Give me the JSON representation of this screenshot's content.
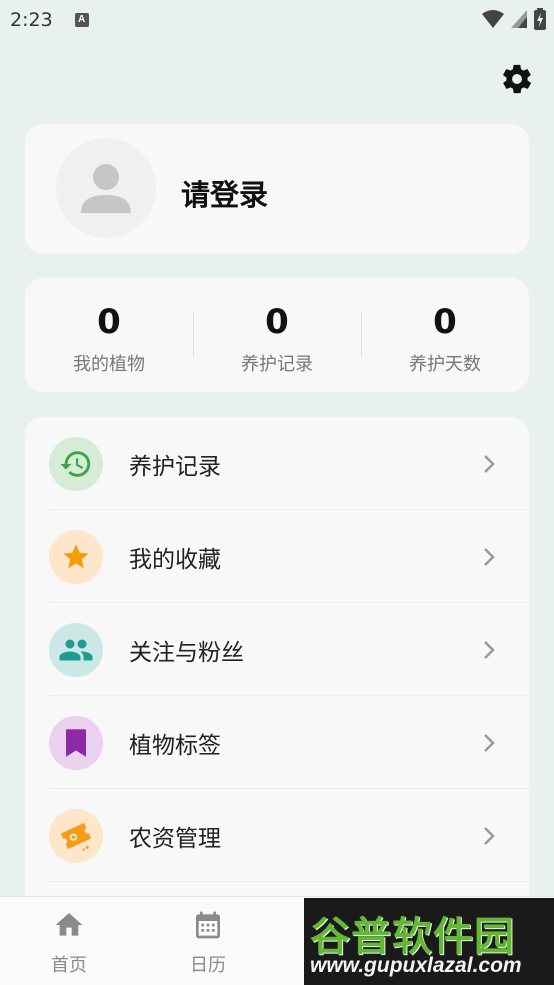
{
  "status_bar": {
    "time": "2:23",
    "notification_badge": "A"
  },
  "header": {
    "settings_icon": "gear-icon"
  },
  "profile": {
    "login_text": "请登录",
    "avatar_icon": "person-icon"
  },
  "stats": [
    {
      "value": "0",
      "label": "我的植物"
    },
    {
      "value": "0",
      "label": "养护记录"
    },
    {
      "value": "0",
      "label": "养护天数"
    }
  ],
  "menu": [
    {
      "label": "养护记录",
      "icon": "history-icon",
      "icon_color": "#43a047",
      "bg_color": "#d5ecd6"
    },
    {
      "label": "我的收藏",
      "icon": "star-icon",
      "icon_color": "#f59c0b",
      "bg_color": "#fde6c9"
    },
    {
      "label": "关注与粉丝",
      "icon": "people-icon",
      "icon_color": "#1f9b92",
      "bg_color": "#cce8e6"
    },
    {
      "label": "植物标签",
      "icon": "bookmark-icon",
      "icon_color": "#8e2aa7",
      "bg_color": "#ead2ee"
    },
    {
      "label": "农资管理",
      "icon": "ticket-icon",
      "icon_color": "#f39d1b",
      "bg_color": "#fde6c9"
    }
  ],
  "bottom_nav": [
    {
      "label": "首页",
      "icon": "home-icon"
    },
    {
      "label": "日历",
      "icon": "calendar-icon"
    }
  ],
  "watermark": {
    "title": "谷普软件园",
    "url": "www.gupuxlazal.com"
  }
}
